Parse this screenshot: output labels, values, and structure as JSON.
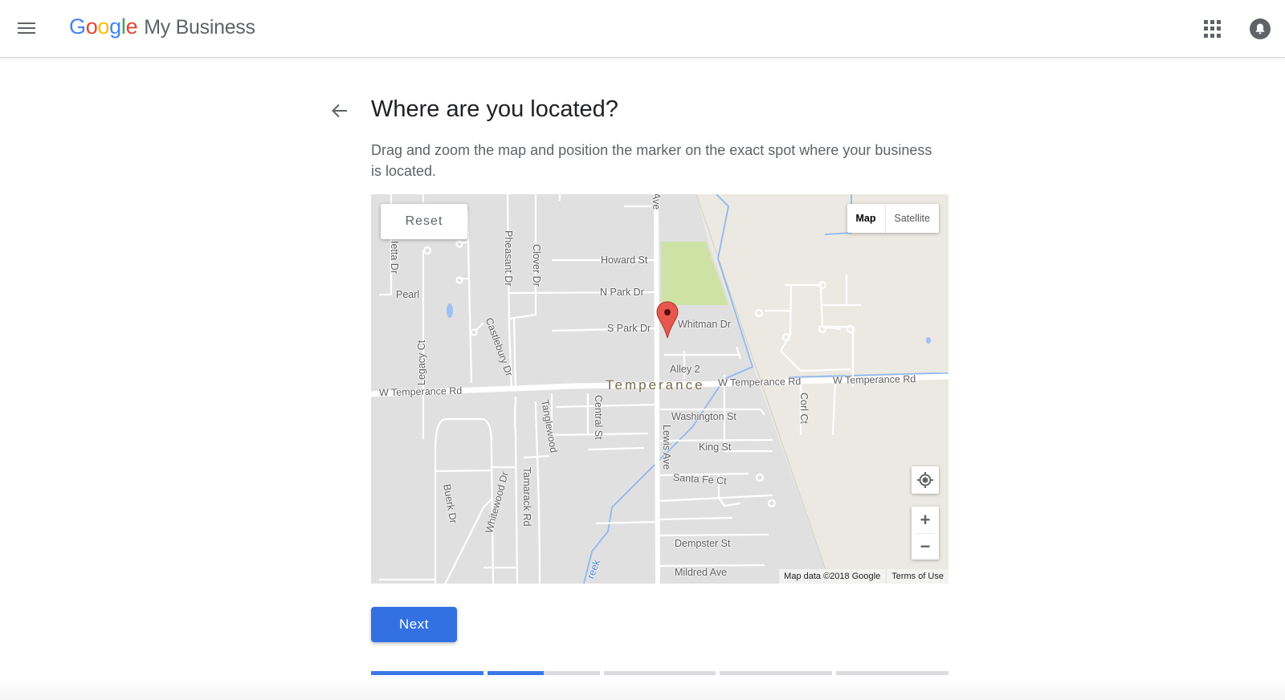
{
  "header": {
    "menu_icon": "hamburger-menu-icon",
    "logo_letters": [
      "G",
      "o",
      "o",
      "g",
      "l",
      "e"
    ],
    "product_name": "My Business",
    "apps_icon": "apps-grid-icon",
    "notifications_icon": "bell-icon"
  },
  "page": {
    "back_icon": "arrow-back-icon",
    "title": "Where are you located?",
    "description": "Drag and zoom the map and position the marker on the exact spot where your business is located."
  },
  "map": {
    "reset_label": "Reset",
    "map_type": {
      "options": [
        "Map",
        "Satellite"
      ],
      "selected": "Map"
    },
    "locate_icon": "my-location-icon",
    "zoom_in_label": "+",
    "zoom_out_label": "−",
    "attribution": "Map data ©2018 Google",
    "terms_label": "Terms of Use",
    "marker_icon": "map-pin-icon",
    "town_label": "Temperance",
    "street_labels": {
      "howard": "Howard St",
      "npark": "N Park Dr",
      "spark": "S Park Dr",
      "whitman": "Whitman Dr",
      "alley2": "Alley 2",
      "pearl": "Pearl",
      "wtemp1": "W Temperance Rd",
      "wtemp2": "W Temperance Rd",
      "wtemp3": "W Temperance Rd",
      "washington": "Washington St",
      "king": "King St",
      "santafe": "Santa Fe Ct",
      "dempster": "Dempster St",
      "mildred": "Mildred Ave",
      "lewis": "Lewis Ave",
      "ave_top": "Ave",
      "central": "Central St",
      "tanglewood": "Tanglewood",
      "tamarack": "Tamarack Rd",
      "whitewood": "Whitewood Dr",
      "buerk": "Buerk Dr",
      "legacy": "Legacy Ct",
      "castlebury": "Castlebury Dr",
      "pheasant": "Pheasant Dr",
      "clover": "Clover Dr",
      "ietta": "Ietta Dr",
      "corl": "Corl Ct",
      "creek": "reek"
    }
  },
  "actions": {
    "next_label": "Next"
  },
  "progress": {
    "steps_total": 5,
    "step_fill": [
      1,
      0.5,
      0,
      0,
      0
    ]
  },
  "colors": {
    "primary": "#3371e3",
    "progress_fill": "#3b78e7",
    "progress_track": "#dadce0",
    "map_bg": "#e0e0e0",
    "park": "#cfe2a6",
    "rural": "#ebe9e1",
    "water": "#7fb0f0",
    "marker": "#e8574d"
  }
}
